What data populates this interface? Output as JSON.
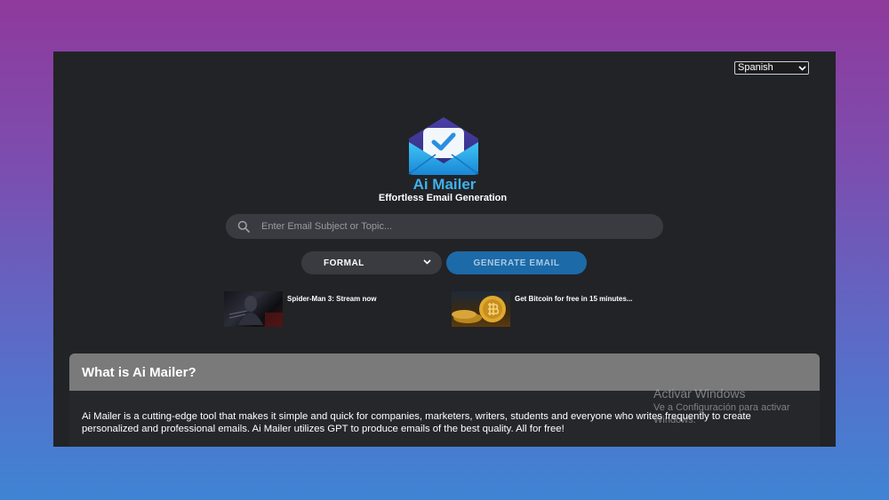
{
  "language_select": {
    "value": "Spanish"
  },
  "app": {
    "title": "Ai Mailer",
    "subtitle": "Effortless Email Generation"
  },
  "search": {
    "placeholder": "Enter Email Subject or Topic..."
  },
  "tone_select": {
    "value": "FORMAL"
  },
  "generate_button": {
    "label": "GENERATE EMAIL"
  },
  "ads": [
    {
      "caption": "Spider-Man 3: Stream now"
    },
    {
      "caption": "Get Bitcoin for free in 15 minutes..."
    }
  ],
  "info_card": {
    "title": "What is Ai Mailer?",
    "body": "Ai Mailer is a cutting-edge tool that makes it simple and quick for companies, marketers, writers, students and everyone who writes frequently to create personalized and professional emails. Ai Mailer utilizes GPT to produce emails of the best quality. All for free!"
  },
  "watermark": {
    "title": "Activar Windows",
    "subtitle": "Ve a Configuración para activar Windows."
  },
  "colors": {
    "accent_blue": "#3eb2ee",
    "button_blue": "#1d6aa8",
    "window_bg": "#222326",
    "card_header": "#7a7a7b"
  },
  "icons": {
    "logo": "envelope-check-icon",
    "search": "search-icon",
    "dropdown": "chevron-down-icon"
  }
}
